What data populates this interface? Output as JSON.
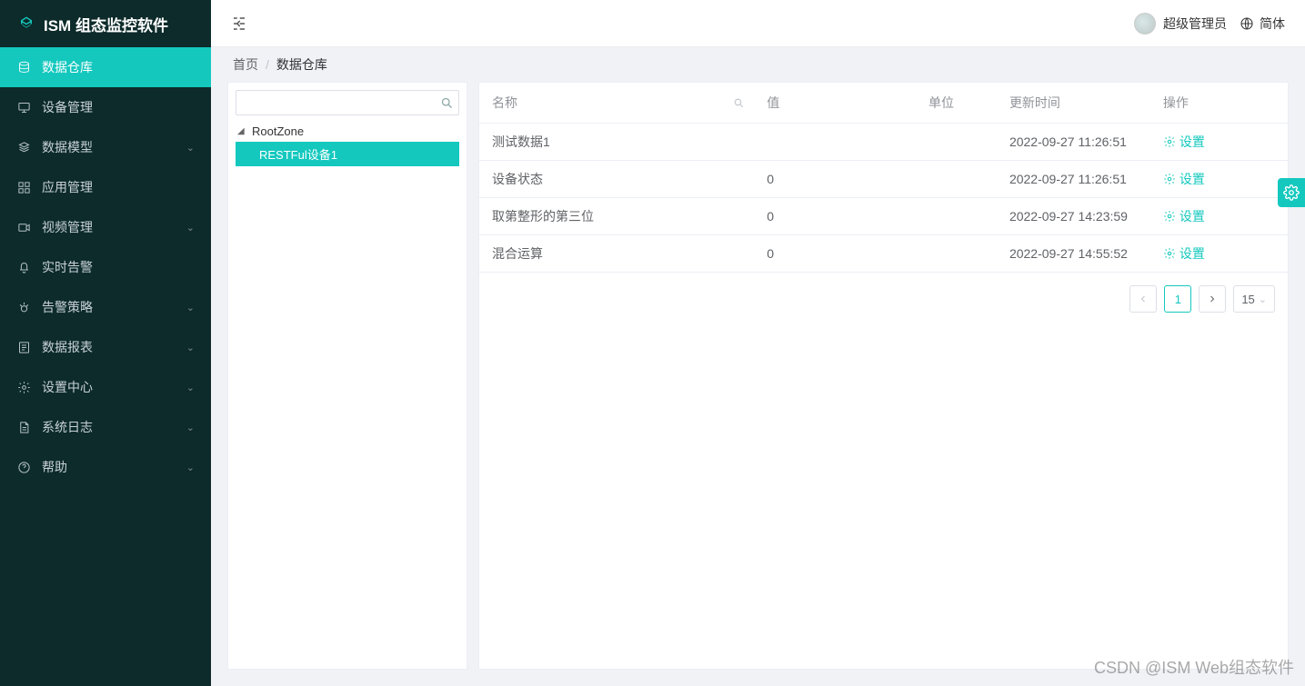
{
  "brand": {
    "title": "ISM 组态监控软件"
  },
  "sidebar": {
    "items": [
      {
        "label": "数据仓库",
        "icon": "database-icon",
        "expandable": false,
        "active": true
      },
      {
        "label": "设备管理",
        "icon": "device-icon",
        "expandable": false
      },
      {
        "label": "数据模型",
        "icon": "model-icon",
        "expandable": true
      },
      {
        "label": "应用管理",
        "icon": "app-icon",
        "expandable": false
      },
      {
        "label": "视频管理",
        "icon": "video-icon",
        "expandable": true
      },
      {
        "label": "实时告警",
        "icon": "bell-icon",
        "expandable": false
      },
      {
        "label": "告警策略",
        "icon": "strategy-icon",
        "expandable": true
      },
      {
        "label": "数据报表",
        "icon": "report-icon",
        "expandable": true
      },
      {
        "label": "设置中心",
        "icon": "settings-icon",
        "expandable": true
      },
      {
        "label": "系统日志",
        "icon": "log-icon",
        "expandable": true
      },
      {
        "label": "帮助",
        "icon": "help-icon",
        "expandable": true
      }
    ]
  },
  "topbar": {
    "user_label": "超级管理员",
    "lang_label": "简体"
  },
  "breadcrumb": {
    "home": "首页",
    "current": "数据仓库"
  },
  "tree": {
    "search_placeholder": "",
    "root": "RootZone",
    "children": [
      {
        "label": "RESTFul设备1",
        "selected": true
      }
    ]
  },
  "table": {
    "headers": {
      "name": "名称",
      "value": "值",
      "unit": "单位",
      "time": "更新时间",
      "op": "操作"
    },
    "op_label": "设置",
    "rows": [
      {
        "name": "测试数据1",
        "value": "",
        "unit": "",
        "time": "2022-09-27 11:26:51"
      },
      {
        "name": "设备状态",
        "value": "0",
        "unit": "",
        "time": "2022-09-27 11:26:51"
      },
      {
        "name": "取第整形的第三位",
        "value": "0",
        "unit": "",
        "time": "2022-09-27 14:23:59"
      },
      {
        "name": "混合运算",
        "value": "0",
        "unit": "",
        "time": "2022-09-27 14:55:52"
      }
    ]
  },
  "pagination": {
    "current_page": "1",
    "page_size_label": "15"
  },
  "watermark": "CSDN @ISM Web组态软件"
}
